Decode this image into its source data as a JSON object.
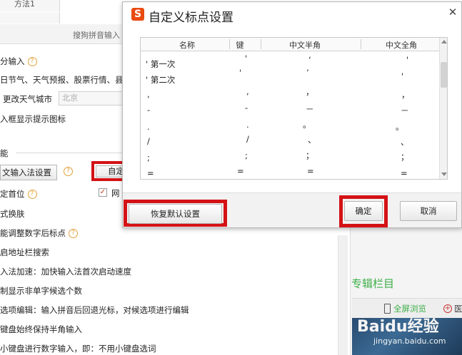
{
  "background": {
    "tab_label": "方法1",
    "window_title": "搜狗拼音输入",
    "rows": [
      {
        "label": "分输入"
      },
      {
        "label": "日节气、天气预报、股票行情、县"
      },
      {
        "label": "入框显示提示图标"
      }
    ],
    "city": {
      "label": "更改天气城市",
      "value": "北京"
    },
    "section_label": "能",
    "input_manager_button": "文输入法设置",
    "self_button": "自定",
    "checkbox_row": {
      "label": "定首位",
      "checked": true
    },
    "net_label": "网",
    "options": [
      "式换肤",
      "能调整数字后标点",
      "启地址栏搜索",
      "入法加速：加快输入法首次启动速度",
      "制显示非单字候选个数",
      "选项编辑：输入拼音后回退光标，对候选项进行编辑",
      "键盘始终保持半角输入",
      "小键盘进行数字输入，即：不用小键盘选词"
    ],
    "side_title": "专辑栏目",
    "fullscreen_label": "全屏浏览",
    "more_label": "医",
    "watermark": "Baidu经验",
    "watermark_url": "jingyan.baidu.com"
  },
  "dialog": {
    "logo": "S",
    "title": "自定义标点设置",
    "close_glyph": "✕",
    "columns": [
      "名称",
      "键",
      "中文半角",
      "中文全角"
    ],
    "rows": [
      {
        "name": "' 第一次",
        "key": "'",
        "half": "‘",
        "full": "'"
      },
      {
        "name": "' 第二次",
        "key": "'",
        "half": "’",
        "full": "'"
      },
      {
        "name": ",",
        "key": ",",
        "half": "，",
        "full": "，"
      },
      {
        "name": "-",
        "key": "-",
        "half": "－",
        "full": "－"
      },
      {
        "name": ".",
        "key": ".",
        "half": "。",
        "full": "。"
      },
      {
        "name": "/",
        "key": "/",
        "half": "、",
        "full": "、"
      },
      {
        "name": ";",
        "key": ";",
        "half": "；",
        "full": "；"
      },
      {
        "name": "=",
        "key": "=",
        "half": "=",
        "full": "="
      }
    ],
    "buttons": {
      "restore": "恢复默认设置",
      "ok": "确定",
      "cancel": "取消"
    }
  },
  "colors": {
    "highlight_frame": "#d41216",
    "accent_green": "#3cae46",
    "logo_orange": "#e94a10"
  }
}
